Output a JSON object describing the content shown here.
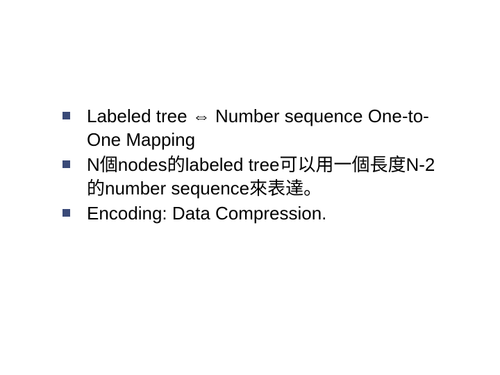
{
  "bullets": [
    {
      "text": "Labeled tree ⇔ Number sequence One-to-One Mapping"
    },
    {
      "text": "N個nodes的labeled tree可以用一個長度N-2的number sequence來表達。"
    },
    {
      "text": "Encoding: Data Compression."
    }
  ]
}
